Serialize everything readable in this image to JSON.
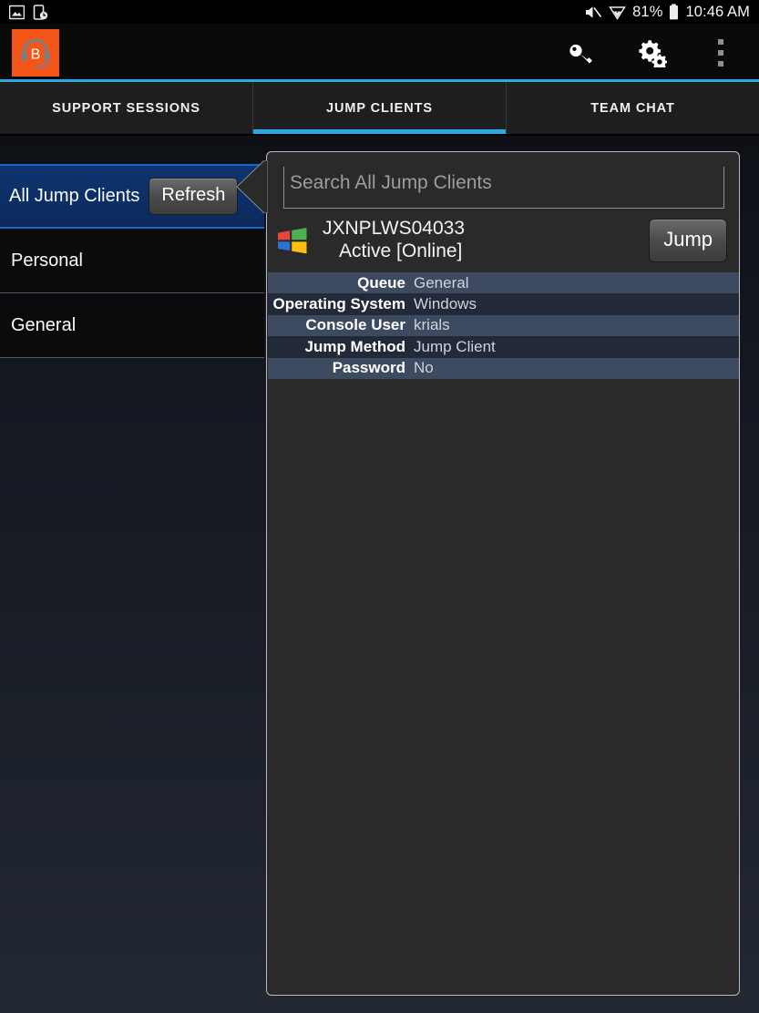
{
  "status_bar": {
    "left_icons": [
      "screenshot-icon",
      "device-clock-icon"
    ],
    "mute_icon": "volume-mute-icon",
    "wifi_icon": "wifi-icon",
    "battery_percent": "81%",
    "battery_icon": "battery-icon",
    "time": "10:46 AM"
  },
  "app_bar": {
    "logo_letter": "B",
    "logo_color": "#f4561a",
    "actions": [
      "key-icon",
      "settings-gears-icon",
      "overflow-menu-icon"
    ],
    "accent_color": "#29abe2"
  },
  "tabs": [
    {
      "label": "SUPPORT SESSIONS",
      "active": false
    },
    {
      "label": "JUMP CLIENTS",
      "active": true
    },
    {
      "label": "TEAM CHAT",
      "active": false
    }
  ],
  "sidebar": {
    "items": [
      {
        "label": "All Jump Clients",
        "selected": true,
        "button": "Refresh"
      },
      {
        "label": "Personal",
        "selected": false
      },
      {
        "label": "General",
        "selected": false
      }
    ]
  },
  "panel": {
    "search": {
      "placeholder": "Search All Jump Clients",
      "value": ""
    },
    "client": {
      "os_icon": "windows-logo-icon",
      "name": "JXNPLWS04033",
      "status": "Active [Online]",
      "jump_label": "Jump"
    },
    "details": [
      {
        "key": "Queue",
        "value": "General"
      },
      {
        "key": "Operating System",
        "value": "Windows"
      },
      {
        "key": "Console User",
        "value": "krials"
      },
      {
        "key": "Jump Method",
        "value": "Jump Client"
      },
      {
        "key": "Password",
        "value": "No"
      }
    ]
  }
}
